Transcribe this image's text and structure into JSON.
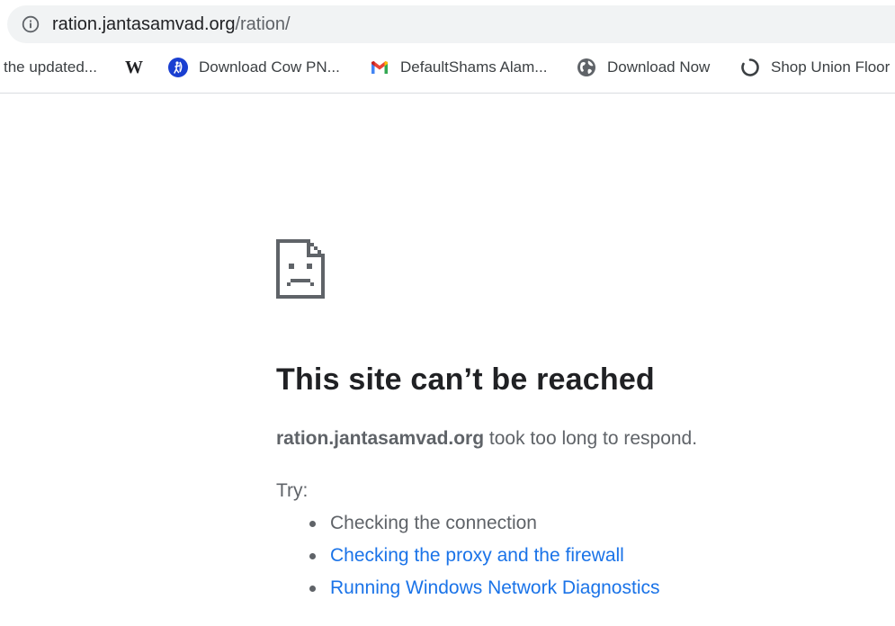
{
  "address_bar": {
    "host": "ration.jantasamvad.org",
    "path": "/ration/"
  },
  "bookmarks": [
    {
      "icon": "none",
      "label": "the updated..."
    },
    {
      "icon": "wikipedia-icon",
      "label": "W"
    },
    {
      "icon": "archer-icon",
      "label": "Download Cow PN..."
    },
    {
      "icon": "gmail-icon",
      "label": "DefaultShams Alam..."
    },
    {
      "icon": "globe-icon",
      "label": "Download Now"
    },
    {
      "icon": "loading-icon",
      "label": "Shop Union Floor"
    }
  ],
  "error": {
    "headline": "This site can’t be reached",
    "host": "ration.jantasamvad.org",
    "message_rest": " took too long to respond.",
    "try_label": "Try:",
    "suggestions": [
      {
        "text": "Checking the connection",
        "link": false
      },
      {
        "text": "Checking the proxy and the firewall",
        "link": true
      },
      {
        "text": "Running Windows Network Diagnostics",
        "link": true
      }
    ]
  },
  "colors": {
    "link": "#1a73e8",
    "text_secondary": "#5f6368",
    "omnibox_bg": "#f1f3f4"
  }
}
